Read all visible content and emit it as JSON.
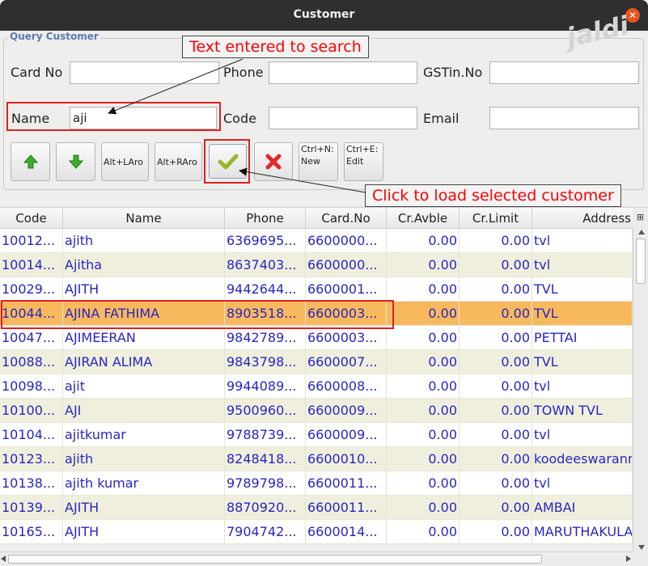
{
  "window": {
    "title": "Customer"
  },
  "watermark": "jaldi",
  "query": {
    "group_title": "Query Customer",
    "labels": {
      "card_no": "Card No",
      "phone": "Phone",
      "gstin": "GSTin.No",
      "name": "Name",
      "code": "Code",
      "email": "Email"
    },
    "values": {
      "card_no": "",
      "phone": "",
      "gstin": "",
      "name": "aji",
      "code": "",
      "email": ""
    }
  },
  "toolbar": {
    "alt_left": "Alt+LAro",
    "alt_right": "Alt+RAro",
    "new_shortcut": "Ctrl+N:",
    "new_label": "New",
    "edit_shortcut": "Ctrl+E:",
    "edit_label": "Edit"
  },
  "annotations": {
    "search_text": "Text entered to search",
    "load_customer": "Click to load selected customer"
  },
  "table": {
    "columns": [
      "Code",
      "Name",
      "Phone",
      "Card.No",
      "Cr.Avble",
      "Cr.Limit",
      "Address"
    ],
    "rows": [
      [
        "10012...",
        "ajith",
        "6369695...",
        "6600000...",
        "0.00",
        "0.00",
        "tvl"
      ],
      [
        "10014...",
        "Ajitha",
        "8637403...",
        "6600000...",
        "0.00",
        "0.00",
        "tvl"
      ],
      [
        "10029...",
        "AJITH",
        "9442644...",
        "6600001...",
        "0.00",
        "0.00",
        "TVL"
      ],
      [
        "10044...",
        "AJINA FATHIMA",
        "8903518...",
        "6600003...",
        "0.00",
        "0.00",
        "TVL"
      ],
      [
        "10047...",
        "AJIMEERAN",
        "9842789...",
        "6600003...",
        "0.00",
        "0.00",
        "PETTAI"
      ],
      [
        "10088...",
        "AJIRAN ALIMA",
        "9843798...",
        "6600007...",
        "0.00",
        "0.00",
        "TVL"
      ],
      [
        "10098...",
        "ajit",
        "9944089...",
        "6600008...",
        "0.00",
        "0.00",
        "tvl"
      ],
      [
        "10100...",
        "AJI",
        "9500960...",
        "6600009...",
        "0.00",
        "0.00",
        "TOWN TVL"
      ],
      [
        "10104...",
        "ajitkumar",
        "9788739...",
        "6600009...",
        "0.00",
        "0.00",
        "tvl"
      ],
      [
        "10123...",
        "ajith",
        "8248418...",
        "6600010...",
        "0.00",
        "0.00",
        "koodeeswarann"
      ],
      [
        "10138...",
        "ajith kumar",
        "9789798...",
        "6600011...",
        "0.00",
        "0.00",
        "tvl"
      ],
      [
        "10139...",
        "AJITH",
        "8870920...",
        "6600011...",
        "0.00",
        "0.00",
        "AMBAI"
      ],
      [
        "10165...",
        "AJITH",
        "7904742...",
        "6600014...",
        "0.00",
        "0.00",
        "MARUTHAKULA"
      ]
    ],
    "selected_index": 3
  },
  "colors": {
    "row_even": "#ffffff",
    "row_odd": "#f0efdd",
    "row_selected": "#f8b95e",
    "text_blue": "#2626c4",
    "annotation_red": "#e02020"
  }
}
